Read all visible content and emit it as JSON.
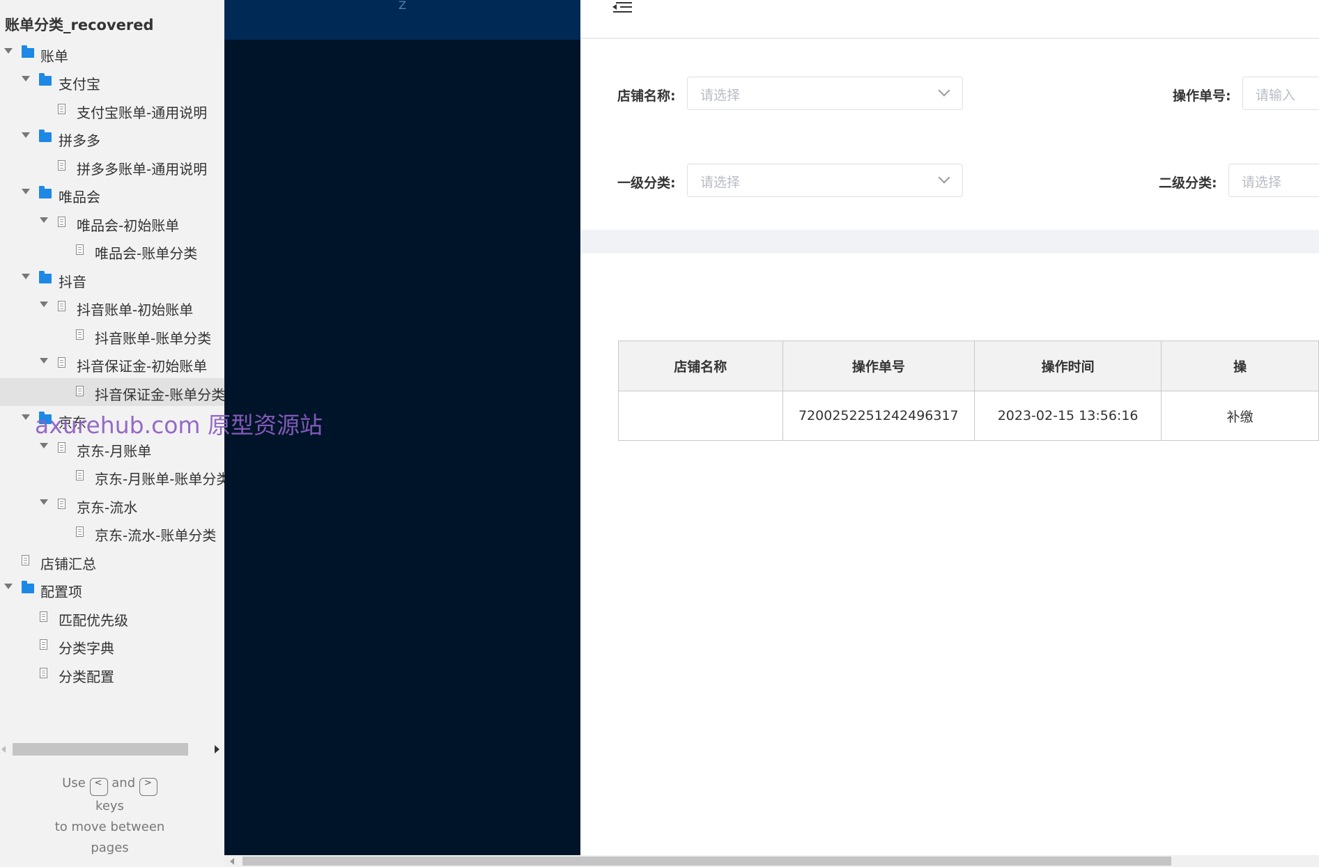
{
  "sitemap": {
    "title": "账单分类_recovered",
    "nodes": [
      {
        "label": "账单",
        "kind": "folder",
        "expanded": true
      },
      {
        "label": "支付宝",
        "kind": "folder",
        "expanded": true
      },
      {
        "label": "支付宝账单-通用说明",
        "kind": "page",
        "expanded": false
      },
      {
        "label": "拼多多",
        "kind": "folder",
        "expanded": true
      },
      {
        "label": "拼多多账单-通用说明",
        "kind": "page",
        "expanded": false
      },
      {
        "label": "唯品会",
        "kind": "folder",
        "expanded": true
      },
      {
        "label": "唯品会-初始账单",
        "kind": "page",
        "expanded": true
      },
      {
        "label": "唯品会-账单分类",
        "kind": "page",
        "expanded": false
      },
      {
        "label": "抖音",
        "kind": "folder",
        "expanded": true
      },
      {
        "label": "抖音账单-初始账单",
        "kind": "page",
        "expanded": true
      },
      {
        "label": "抖音账单-账单分类",
        "kind": "page",
        "expanded": false
      },
      {
        "label": "抖音保证金-初始账单",
        "kind": "page",
        "expanded": true
      },
      {
        "label": "抖音保证金-账单分类",
        "kind": "page",
        "expanded": false,
        "selected": true
      },
      {
        "label": "京东",
        "kind": "folder",
        "expanded": true
      },
      {
        "label": "京东-月账单",
        "kind": "page",
        "expanded": true
      },
      {
        "label": "京东-月账单-账单分类",
        "kind": "page",
        "expanded": false
      },
      {
        "label": "京东-流水",
        "kind": "page",
        "expanded": true
      },
      {
        "label": "京东-流水-账单分类",
        "kind": "page",
        "expanded": false
      },
      {
        "label": "店铺汇总",
        "kind": "page",
        "expanded": false
      },
      {
        "label": "配置项",
        "kind": "folder",
        "expanded": true
      },
      {
        "label": "匹配优先级",
        "kind": "page",
        "expanded": false
      },
      {
        "label": "分类字典",
        "kind": "page",
        "expanded": false
      },
      {
        "label": "分类配置",
        "kind": "page",
        "expanded": false
      }
    ],
    "hint": {
      "use": "Use",
      "prev_key": "<",
      "and": "and",
      "next_key": ">",
      "keys": "keys",
      "line2": "to move between",
      "line3": "pages"
    }
  },
  "watermark": "axurehub.com 原型资源站",
  "dark_header_text": "Z",
  "filters": {
    "store_name_label": "店铺名称:",
    "store_name_placeholder": "请选择",
    "op_no_label": "操作单号:",
    "op_no_placeholder": "请输入",
    "level1_label": "一级分类:",
    "level1_placeholder": "请选择",
    "level2_label": "二级分类:",
    "level2_placeholder": "请选择"
  },
  "table": {
    "headers": [
      "店铺名称",
      "操作单号",
      "操作时间",
      "操"
    ],
    "rows": [
      [
        "",
        "7200252251242496317",
        "2023-02-15 13:56:16",
        "补缴"
      ]
    ]
  },
  "colors": {
    "sidebar_bg": "#f2f2f2",
    "dark_panel": "#001429",
    "dark_header": "#002a55",
    "folder_icon": "#1e88e5",
    "watermark": "#8c5fc2"
  }
}
